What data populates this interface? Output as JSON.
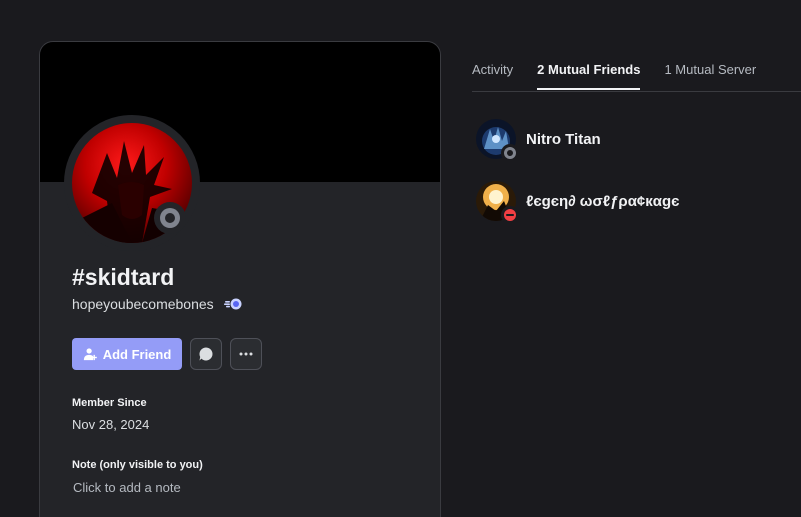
{
  "profile": {
    "display_name": "#skidtard",
    "username": "hopeyoubecomebones",
    "badge_icon": "nitro-badge-icon",
    "status": "offline",
    "actions": {
      "add_friend_label": "Add Friend",
      "message_icon": "chat-bubble-icon",
      "more_icon": "ellipsis-icon"
    },
    "member_since_label": "Member Since",
    "member_since_value": "Nov 28, 2024",
    "note_label": "Note (only visible to you)",
    "note_placeholder": "Click to add a note"
  },
  "tabs": [
    {
      "label": "Activity",
      "active": false
    },
    {
      "label": "2 Mutual Friends",
      "active": true
    },
    {
      "label": "1 Mutual Server",
      "active": false
    }
  ],
  "mutual_friends": [
    {
      "name": "Nitro Titan",
      "status": "offline"
    },
    {
      "name": "ℓєgєη∂ ωσℓƒρα¢кαgє",
      "status": "dnd"
    }
  ],
  "colors": {
    "background": "#1a1a1e",
    "card": "#232428",
    "accent_button": "#949cf7",
    "offline": "#80848e",
    "dnd": "#f23f43"
  }
}
